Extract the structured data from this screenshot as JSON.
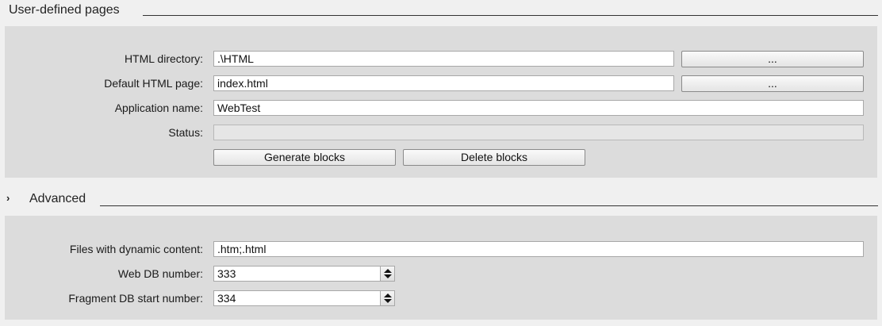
{
  "user_pages": {
    "section_title": "User-defined pages",
    "html_directory": {
      "label": "HTML directory:",
      "value": ".\\HTML",
      "browse_label": "..."
    },
    "default_html_page": {
      "label": "Default HTML page:",
      "value": "index.html",
      "browse_label": "..."
    },
    "application_name": {
      "label": "Application name:",
      "value": "WebTest"
    },
    "status": {
      "label": "Status:",
      "value": ""
    },
    "generate_blocks_label": "Generate blocks",
    "delete_blocks_label": "Delete blocks"
  },
  "advanced": {
    "section_title": "Advanced",
    "expand_glyph": "›",
    "dynamic_files": {
      "label": "Files with dynamic content:",
      "value": ".htm;.html"
    },
    "web_db_number": {
      "label": "Web DB number:",
      "value": "333"
    },
    "fragment_db_start": {
      "label": "Fragment DB start number:",
      "value": "334"
    }
  }
}
